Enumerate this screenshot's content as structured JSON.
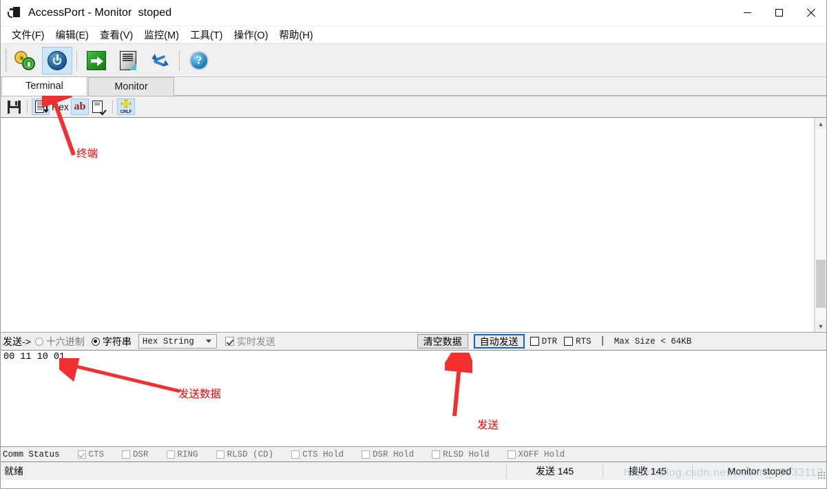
{
  "window": {
    "title": "AccessPort - Monitor  stoped",
    "icon": "serial-plug-icon",
    "minimize_label": "–",
    "maximize_label": "□",
    "close_label": "✕"
  },
  "menubar": {
    "items": [
      {
        "label": "文件(F)",
        "name": "menu-file"
      },
      {
        "label": "编辑(E)",
        "name": "menu-edit"
      },
      {
        "label": "查看(V)",
        "name": "menu-view"
      },
      {
        "label": "监控(M)",
        "name": "menu-monitor"
      },
      {
        "label": "工具(T)",
        "name": "menu-tools"
      },
      {
        "label": "操作(O)",
        "name": "menu-operate"
      },
      {
        "label": "帮助(H)",
        "name": "menu-help"
      }
    ]
  },
  "toolbar": {
    "buttons": [
      {
        "icon": "gears-settings-icon",
        "active": false
      },
      {
        "icon": "power-icon",
        "active": true
      },
      {
        "icon": "green-arrow-send-icon",
        "active": false
      },
      {
        "icon": "document-icon",
        "active": false
      },
      {
        "icon": "refresh-arrows-icon",
        "active": false
      },
      {
        "icon": "help-globe-icon",
        "active": false
      }
    ]
  },
  "tabs": [
    {
      "label": "Terminal",
      "active": true,
      "name": "tab-terminal"
    },
    {
      "label": "Monitor",
      "active": false,
      "name": "tab-monitor"
    }
  ],
  "subtoolbar": {
    "buttons": [
      {
        "icon": "save-icon",
        "active": false
      },
      {
        "icon": "hex-dump-icon",
        "active": true
      },
      {
        "icon": "hex-label",
        "text": "Hex",
        "active": false
      },
      {
        "icon": "ab-ascii-icon",
        "text": "ab",
        "active": true
      },
      {
        "icon": "edit-check-icon",
        "active": false
      },
      {
        "icon": "crlf-icon",
        "text": "CRLF",
        "active": true
      }
    ]
  },
  "terminal": {
    "content": "",
    "scrollbar": {
      "up_arrow": "▲",
      "down_arrow": "▼"
    }
  },
  "sendbar": {
    "label": "发送->",
    "radio_hex": {
      "label": "十六进制",
      "checked": false,
      "enabled": false
    },
    "radio_string": {
      "label": "字符串",
      "checked": true,
      "enabled": true
    },
    "combo_value": "Hex String",
    "realtime_send": {
      "label": "实时发送",
      "checked": true,
      "enabled": false
    },
    "clear_data_button": "清空数据",
    "auto_send_button": "自动发送",
    "dtr": {
      "label": "DTR",
      "checked": false
    },
    "rts": {
      "label": "RTS",
      "checked": false
    },
    "separator": "|",
    "max_size_note": "Max Size < 64KB"
  },
  "sendedit": {
    "value": "00 11 10 01"
  },
  "commstatus": {
    "title": "Comm Status",
    "items": [
      {
        "label": "CTS",
        "checked": true
      },
      {
        "label": "DSR",
        "checked": false
      },
      {
        "label": "RING",
        "checked": false
      },
      {
        "label": "RLSD (CD)",
        "checked": false
      },
      {
        "label": "CTS Hold",
        "checked": false
      },
      {
        "label": "DSR Hold",
        "checked": false
      },
      {
        "label": "RLSD Hold",
        "checked": false
      },
      {
        "label": "XOFF Hold",
        "checked": false
      }
    ]
  },
  "statusbar": {
    "ready": "就绪",
    "sent": "发送 145",
    "received": "接收 145",
    "monitor": "Monitor  stoped"
  },
  "annotations": [
    {
      "text": "终端",
      "name": "annotation-terminal"
    },
    {
      "text": "发送数据",
      "name": "annotation-send-data"
    },
    {
      "text": "发送",
      "name": "annotation-send"
    }
  ],
  "watermark": "https://blog.csdn.net/weixin_45833112",
  "colors": {
    "annotation_red": "#ff0000",
    "accent_blue": "#0a64c8",
    "toolbar_bg": "#f0f0f0"
  }
}
